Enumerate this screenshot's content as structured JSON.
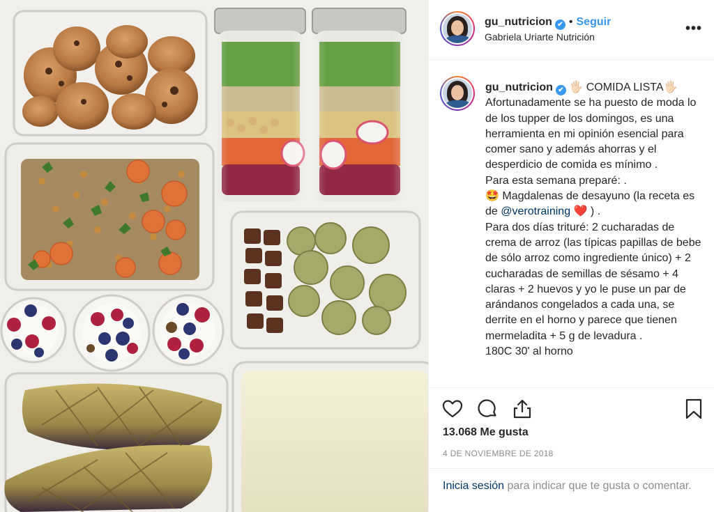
{
  "post": {
    "username": "gu_nutricion",
    "verified_mark": "✔",
    "separator": "•",
    "follow_label": "Seguir",
    "display_name": "Gabriela Uriarte Nutrición",
    "more_label": "•••",
    "image_alt": "Tuppers de comida preparada para la semana",
    "icons": [
      "verified-badge-icon",
      "more-options-icon",
      "heart-icon",
      "comment-icon",
      "share-icon",
      "bookmark-icon"
    ]
  },
  "caption": {
    "username": "gu_nutricion",
    "hand_left": "🖐🏻",
    "title": "COMIDA LISTA",
    "hand_right": "🖐🏻",
    "para1": "Afortunadamente se ha puesto de moda lo de los tupper de los domingos, es una herramienta en mi opinión esencial para comer sano y además ahorras y el desperdicio de comida es mínimo .",
    "para2": "Para esta semana preparé: .",
    "emoji_face": "🤩",
    "item1_start": " Magdalenas de desayuno (la receta es de ",
    "mention": "@verotraining",
    "heart": "❤️",
    "item1_end": " ) .",
    "para3": "Para dos días trituré: 2 cucharadas de crema de arroz (las típicas papillas de bebe de sólo arroz como ingrediente único) + 2 cucharadas de semillas de sésamo + 4 claras + 2 huevos y yo le puse un par de arándanos congelados a cada una, se derrite en el horno y parece que tienen mermeladita + 5 g de levadura .",
    "para4": "180C 30' al horno"
  },
  "stats": {
    "likes": "13.068 Me gusta",
    "date": "4 DE NOVIEMBRE DE 2018"
  },
  "login_prompt": {
    "link": "Inicia sesión",
    "rest": " para indicar que te gusta o comentar."
  },
  "colors": {
    "accent_blue": "#3897f0",
    "link_dark_blue": "#003569",
    "muted_gray": "#8e8e8e",
    "text": "#262626",
    "border": "#efefef"
  }
}
